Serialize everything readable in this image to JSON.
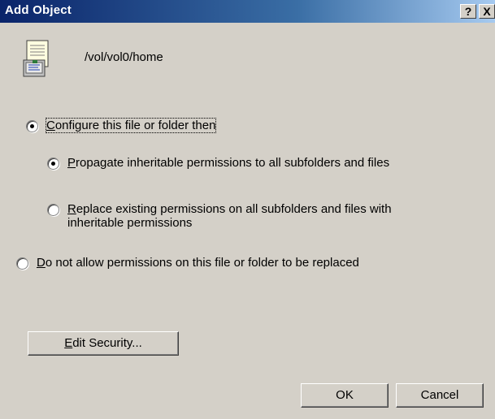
{
  "window": {
    "title": "Add Object",
    "help_label": "?",
    "close_label": "X"
  },
  "object": {
    "path": "/vol/vol0/home",
    "icon": "document-icon"
  },
  "options": {
    "configure": {
      "label_key": "C",
      "label_rest": "onfigure this file or folder then",
      "checked": true
    },
    "propagate": {
      "label_key": "P",
      "label_rest": "ropagate inheritable permissions to all subfolders and files",
      "checked": true
    },
    "replace": {
      "label_key": "R",
      "label_rest": "eplace existing permissions on all subfolders and files with",
      "label_line2": "inheritable permissions",
      "checked": false
    },
    "do_not_allow": {
      "label_key": "D",
      "label_rest": "o not allow permissions on this file or folder to be replaced",
      "checked": false
    }
  },
  "buttons": {
    "edit_security_key": "E",
    "edit_security_rest": "dit Security...",
    "ok": "OK",
    "cancel": "Cancel"
  },
  "colors": {
    "titlebar_start": "#0a246a",
    "titlebar_end": "#a6caf0",
    "dialog_bg": "#d4d0c8"
  }
}
